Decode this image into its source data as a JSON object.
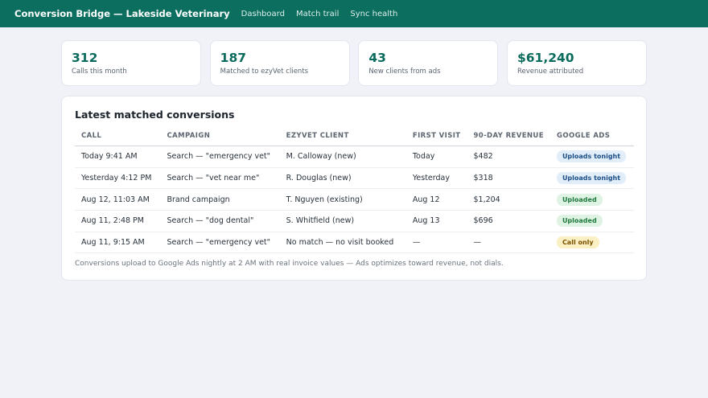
{
  "header": {
    "brand": "Conversion Bridge — Lakeside Veterinary",
    "nav": [
      "Dashboard",
      "Match trail",
      "Sync health"
    ],
    "bar_color": "#0c6e5f"
  },
  "stats": [
    {
      "value": "312",
      "label": "Calls this month"
    },
    {
      "value": "187",
      "label": "Matched to ezyVet clients"
    },
    {
      "value": "43",
      "label": "New clients from ads"
    },
    {
      "value": "$61,240",
      "label": "Revenue attributed"
    }
  ],
  "panel": {
    "title": "Latest matched conversions",
    "columns": [
      "CALL",
      "CAMPAIGN",
      "EZYVET CLIENT",
      "FIRST VISIT",
      "90-DAY REVENUE",
      "GOOGLE ADS"
    ],
    "rows": [
      {
        "call": "Today 9:41 AM",
        "campaign": "Search — \"emergency vet\"",
        "client": "M. Calloway (new)",
        "first_visit": "Today",
        "revenue": "$482",
        "status": "Uploads tonight"
      },
      {
        "call": "Yesterday 4:12 PM",
        "campaign": "Search — \"vet near me\"",
        "client": "R. Douglas (new)",
        "first_visit": "Yesterday",
        "revenue": "$318",
        "status": "Uploads tonight"
      },
      {
        "call": "Aug 12, 11:03 AM",
        "campaign": "Brand campaign",
        "client": "T. Nguyen (existing)",
        "first_visit": "Aug 12",
        "revenue": "$1,204",
        "status": "Uploaded"
      },
      {
        "call": "Aug 11, 2:48 PM",
        "campaign": "Search — \"dog dental\"",
        "client": "S. Whitfield (new)",
        "first_visit": "Aug 13",
        "revenue": "$696",
        "status": "Uploaded"
      },
      {
        "call": "Aug 11, 9:15 AM",
        "campaign": "Search — \"emergency vet\"",
        "client": "No match — no visit booked",
        "first_visit": "—",
        "revenue": "—",
        "status": "Call only"
      }
    ],
    "footnote": "Conversions upload to Google Ads nightly at 2 AM with real invoice values — Ads optimizes toward revenue, not dials."
  }
}
